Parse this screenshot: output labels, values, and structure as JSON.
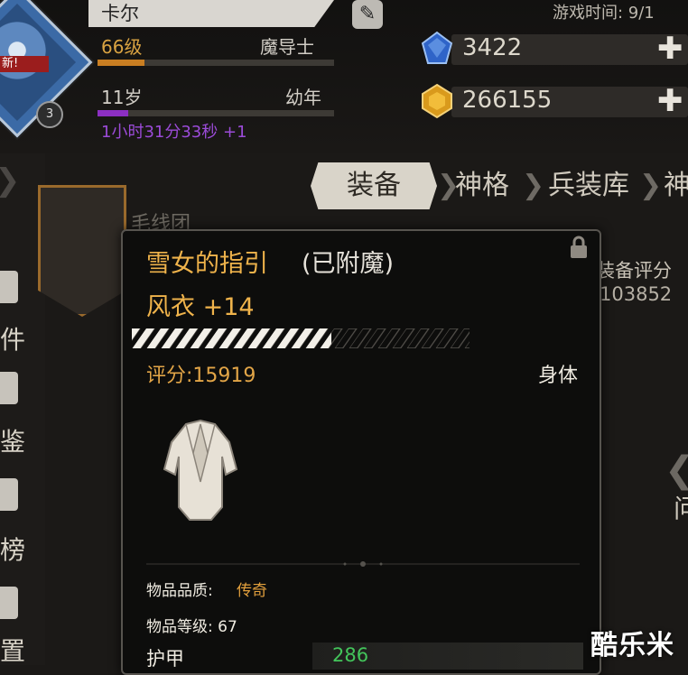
{
  "header": {
    "name": "卡尔",
    "level": "66级",
    "class": "魔导士",
    "level_progress": 0.2,
    "age": "11岁",
    "age_stage": "幼年",
    "age_progress": 0.13,
    "timer": "1小时31分33秒 +1",
    "avatar_flag": "新!",
    "avatar_level": "3",
    "game_time": "游戏时间: 9/1"
  },
  "currency": {
    "gems": "3422",
    "gold": "266155",
    "plus": "✚"
  },
  "tabs": [
    {
      "label": "装备",
      "active": true
    },
    {
      "label": "神格",
      "active": false
    },
    {
      "label": "兵装库",
      "active": false
    },
    {
      "label": "神",
      "active": false
    }
  ],
  "left_menu": [
    "件",
    "鉴",
    "榜",
    "置"
  ],
  "background": {
    "team_label": "毛线团",
    "score_label": "装备评分",
    "score_value": "103852",
    "right_char": "问"
  },
  "tooltip": {
    "name": "雪女的指引",
    "enchant": "(已附魔)",
    "subtitle": "风衣 +14",
    "enhance_progress": 0.59,
    "score": "评分:15919",
    "slot": "身体",
    "quality_label": "物品品质:",
    "quality_value": "传奇",
    "item_level": "物品等级: 67",
    "armor_label": "护甲",
    "armor_value": "286"
  },
  "watermark": "酷乐米",
  "colors": {
    "accent_gold": "#efb34b",
    "quality_legendary": "#e3a03d",
    "stat_green": "#43c55b",
    "age_purple": "#9b4bd8",
    "level_orange": "#c97e22"
  },
  "icons": [
    "edit-icon",
    "gem-icon",
    "gold-icon",
    "plus-icon",
    "lock-icon",
    "jacket-icon"
  ]
}
